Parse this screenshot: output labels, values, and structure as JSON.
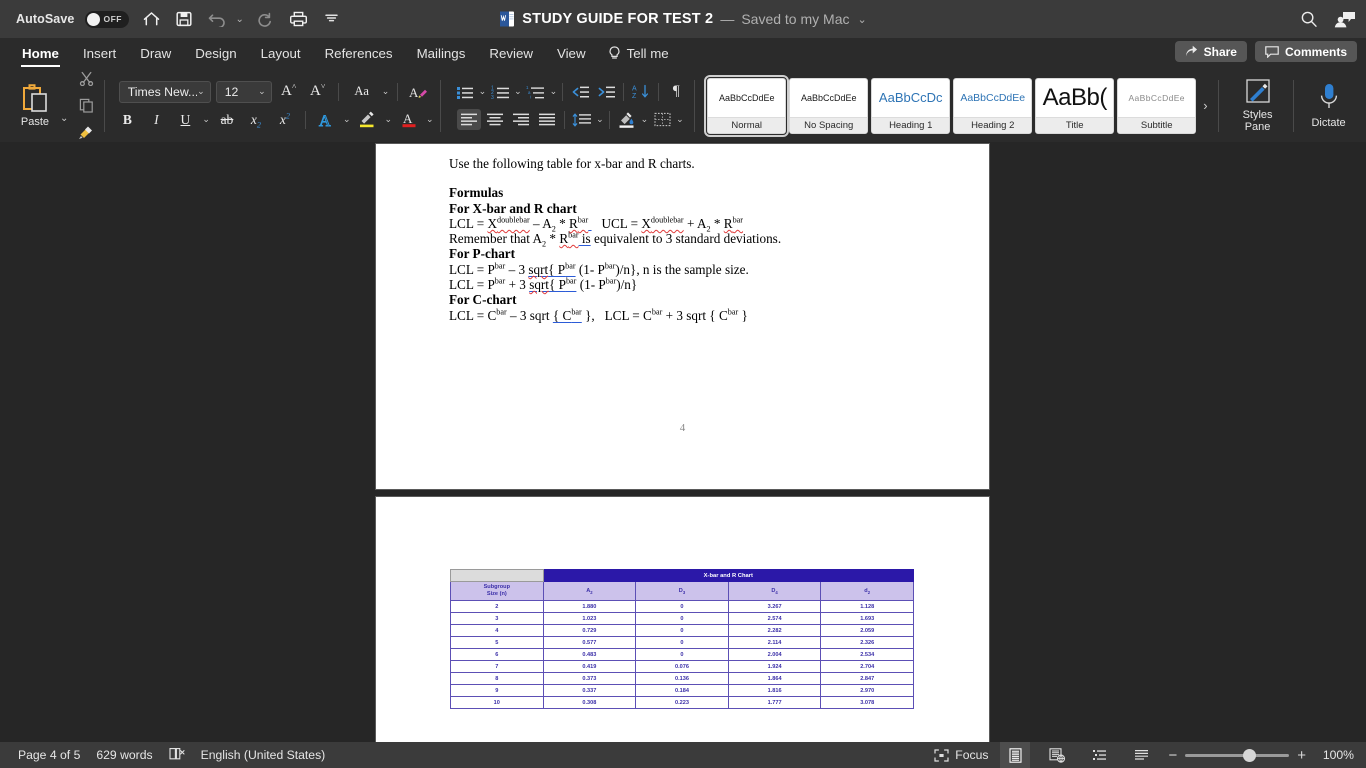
{
  "titlebar": {
    "autosave_label": "AutoSave",
    "autosave_state": "OFF",
    "doc_title": "STUDY GUIDE FOR TEST 2",
    "dash": "—",
    "saved_state": "Saved to my Mac",
    "icons": [
      "home-icon",
      "save-icon",
      "undo-icon",
      "redo-icon",
      "print-icon",
      "customize-toolbar-icon"
    ],
    "right_icons": [
      "search-icon",
      "account-comment-icon"
    ]
  },
  "ribbon": {
    "tabs": [
      {
        "label": "Home",
        "active": true
      },
      {
        "label": "Insert",
        "active": false
      },
      {
        "label": "Draw",
        "active": false
      },
      {
        "label": "Design",
        "active": false
      },
      {
        "label": "Layout",
        "active": false
      },
      {
        "label": "References",
        "active": false
      },
      {
        "label": "Mailings",
        "active": false
      },
      {
        "label": "Review",
        "active": false
      },
      {
        "label": "View",
        "active": false
      }
    ],
    "tell_me": "Tell me",
    "share_label": "Share",
    "comments_label": "Comments",
    "paste_label": "Paste",
    "font_name": "Times New...",
    "font_size": "12",
    "grow_font": "A",
    "shrink_font": "A",
    "change_case": "Aa",
    "bold": "B",
    "italic": "I",
    "underline": "U",
    "strikethrough": "ab",
    "subscript": "x",
    "superscript": "x",
    "text_effects": "A",
    "highlight": "A",
    "font_color": "A",
    "styles_pane_label": "Styles\nPane",
    "styles_pane_line1": "Styles",
    "styles_pane_line2": "Pane",
    "dictate_label": "Dictate",
    "gallery_arrow": "›",
    "styles": [
      {
        "preview": "AaBbCcDdEe",
        "name": "Normal",
        "selected": true,
        "style": "normal"
      },
      {
        "preview": "AaBbCcDdEe",
        "name": "No Spacing",
        "selected": false,
        "style": "nospacing"
      },
      {
        "preview": "AaBbCcDc",
        "name": "Heading 1",
        "selected": false,
        "style": "h1"
      },
      {
        "preview": "AaBbCcDdEe",
        "name": "Heading 2",
        "selected": false,
        "style": "h2"
      },
      {
        "preview": "AaBb(",
        "name": "Title",
        "selected": false,
        "style": "title"
      },
      {
        "preview": "AaBbCcDdEe",
        "name": "Subtitle",
        "selected": false,
        "style": "subtitle"
      }
    ]
  },
  "document": {
    "page1": {
      "intro": "Use the following table for x-bar and R charts.",
      "h_formulas": "Formulas",
      "h_xbar": "For X-bar and R chart",
      "xbar_formula_parts": {
        "lcl_lead": "LCL = X",
        "lcl_sup1": "doublebar",
        "lcl_mid": " – A",
        "lcl_sub": "2",
        "lcl_star": " * R",
        "lcl_sup2": "bar",
        "ucl_lead": "UCL = X",
        "ucl_sup1": "doublebar",
        "ucl_mid": " + A",
        "ucl_sub": "2",
        "ucl_star": " * R",
        "ucl_sup2": "bar"
      },
      "remember_line": "Remember that A2 * Rbar is equivalent to 3 standard deviations.",
      "h_pchart": "For P-chart",
      "p_line1": "LCL = Pbar – 3 sqrt{ Pbar (1- Pbar)/n}, n is the sample size.",
      "p_line2": "LCL = Pbar + 3 sqrt{ Pbar (1- Pbar)/n}",
      "h_cchart": "For C-chart",
      "c_line": "LCL = Cbar – 3 sqrt { Cbar },   LCL = Cbar + 3 sqrt { Cbar }",
      "page_number": "4"
    }
  },
  "chart_data": {
    "type": "table",
    "title": "X-bar and R Chart",
    "corner_header": "",
    "row_header_line1": "Subgroup",
    "row_header_line2": "Size (n)",
    "columns": [
      "A2",
      "D3",
      "D4",
      "d2"
    ],
    "column_labels": [
      {
        "base": "A",
        "sub": "2"
      },
      {
        "base": "D",
        "sub": "3"
      },
      {
        "base": "D",
        "sub": "4"
      },
      {
        "base": "d",
        "sub": "2"
      }
    ],
    "categories": [
      "2",
      "3",
      "4",
      "5",
      "6",
      "7",
      "8",
      "9",
      "10"
    ],
    "series": [
      {
        "name": "A2",
        "values": [
          "1.880",
          "1.023",
          "0.729",
          "0.577",
          "0.483",
          "0.419",
          "0.373",
          "0.337",
          "0.308"
        ]
      },
      {
        "name": "D3",
        "values": [
          "0",
          "0",
          "0",
          "0",
          "0",
          "0.076",
          "0.136",
          "0.184",
          "0.223"
        ]
      },
      {
        "name": "D4",
        "values": [
          "3.267",
          "2.574",
          "2.282",
          "2.114",
          "2.004",
          "1.924",
          "1.864",
          "1.816",
          "1.777"
        ]
      },
      {
        "name": "d2",
        "values": [
          "1.128",
          "1.693",
          "2.059",
          "2.326",
          "2.534",
          "2.704",
          "2.847",
          "2.970",
          "3.078"
        ]
      }
    ],
    "header_color": "#2b18a8",
    "subheader_color": "#ccc2eb",
    "border_color": "#5c4fb5",
    "text_color": "#3b2fa8"
  },
  "statusbar": {
    "page_info": "Page 4 of 5",
    "word_count": "629 words",
    "proofing_icon": "proofing-errors-icon",
    "language": "English (United States)",
    "focus_label": "Focus",
    "views": [
      "print-layout-icon",
      "web-layout-icon",
      "outline-icon",
      "draft-icon"
    ],
    "zoom_minus": "−",
    "zoom_plus": "+",
    "zoom_value": "100%"
  }
}
